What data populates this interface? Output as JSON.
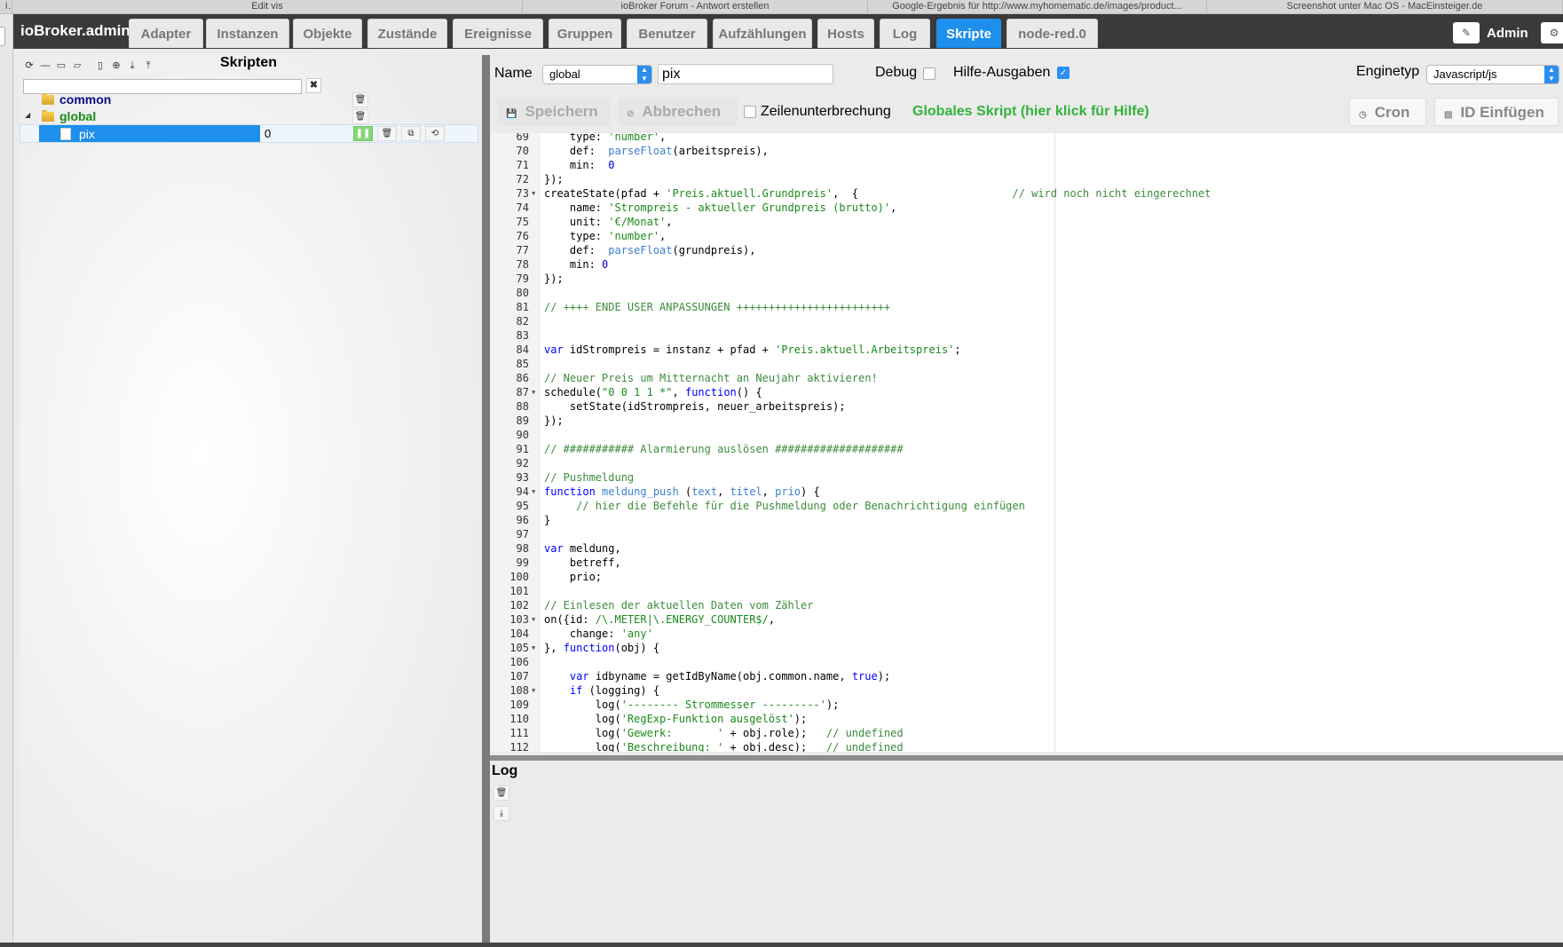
{
  "browser_tabs": [
    {
      "label": "in",
      "width": 14
    },
    {
      "label": "Edit vis",
      "width": 575
    },
    {
      "label": "ioBroker Forum - Antwort erstellen",
      "width": 389
    },
    {
      "label": "Google-Ergebnis für http://www.myhomematic.de/images/product...",
      "width": 382
    },
    {
      "label": "Screenshot unter Mac OS - MacEinsteiger.de",
      "width": 401
    }
  ],
  "brand": "ioBroker.admin",
  "nav_tabs": [
    {
      "name": "adapter",
      "label": "Adapter",
      "active": false
    },
    {
      "name": "instanzen",
      "label": "Instanzen",
      "active": false
    },
    {
      "name": "objekte",
      "label": "Objekte",
      "active": false
    },
    {
      "name": "zustaende",
      "label": "Zustände",
      "active": false
    },
    {
      "name": "ereignisse",
      "label": "Ereignisse",
      "active": false
    },
    {
      "name": "gruppen",
      "label": "Gruppen",
      "active": false
    },
    {
      "name": "benutzer",
      "label": "Benutzer",
      "active": false
    },
    {
      "name": "aufzaehlungen",
      "label": "Aufzählungen",
      "active": false
    },
    {
      "name": "hosts",
      "label": "Hosts",
      "active": false
    },
    {
      "name": "log",
      "label": "Log",
      "active": false
    },
    {
      "name": "skripte",
      "label": "Skripte",
      "active": true
    },
    {
      "name": "node-red",
      "label": "node-red.0",
      "active": false
    }
  ],
  "user": {
    "label": "Admin"
  },
  "scripts_panel": {
    "title": "Skripten",
    "search_value": "",
    "toolbar_icons": [
      "refresh-icon",
      "collapse-icon",
      "folder-icon",
      "folder-open-icon",
      "new-script-icon",
      "add-icon",
      "import-icon",
      "export-icon"
    ],
    "tree": [
      {
        "type": "folder",
        "label": "common",
        "color": "#0a0a8c",
        "expanded": false
      },
      {
        "type": "folder",
        "label": "global",
        "color": "#1a8a1a",
        "expanded": true
      },
      {
        "type": "script",
        "label": "pix",
        "count": "0",
        "selected": true
      }
    ]
  },
  "editor": {
    "name_label": "Name",
    "group_value": "global",
    "name_value": "pix",
    "debug_label": "Debug",
    "debug_checked": false,
    "help_output_label": "Hilfe-Ausgaben",
    "help_output_checked": true,
    "engine_label": "Enginetyp",
    "engine_value": "Javascript/js",
    "save_label": "Speichern",
    "cancel_label": "Abbrechen",
    "wrap_label": "Zeilenunterbrechung",
    "wrap_checked": false,
    "global_help": "Globales Skript (hier klick für Hilfe)",
    "cron_label": "Cron",
    "insert_id_label": "ID Einfügen"
  },
  "code_lines": [
    {
      "n": "69",
      "fold": false,
      "tokens": [
        [
          "",
          "    type: "
        ],
        [
          "st",
          "'number'"
        ],
        [
          "",
          ","
        ]
      ]
    },
    {
      "n": "70",
      "fold": false,
      "tokens": [
        [
          "",
          "    def:  "
        ],
        [
          "fn",
          "parseFloat"
        ],
        [
          "",
          "(arbeitspreis),"
        ]
      ]
    },
    {
      "n": "71",
      "fold": false,
      "tokens": [
        [
          "",
          "    min:  "
        ],
        [
          "nm",
          "0"
        ]
      ]
    },
    {
      "n": "72",
      "fold": false,
      "tokens": [
        [
          "",
          "});"
        ]
      ]
    },
    {
      "n": "73",
      "fold": true,
      "tokens": [
        [
          "",
          "createState(pfad + "
        ],
        [
          "st",
          "'Preis.aktuell.Grundpreis'"
        ],
        [
          "",
          ",  {                        "
        ],
        [
          "cm",
          "// wird noch nicht eingerechnet"
        ]
      ]
    },
    {
      "n": "74",
      "fold": false,
      "tokens": [
        [
          "",
          "    name: "
        ],
        [
          "st",
          "'Strompreis - aktueller Grundpreis (brutto)'"
        ],
        [
          "",
          ","
        ]
      ]
    },
    {
      "n": "75",
      "fold": false,
      "tokens": [
        [
          "",
          "    unit: "
        ],
        [
          "st",
          "'€/Monat'"
        ],
        [
          "",
          ","
        ]
      ]
    },
    {
      "n": "76",
      "fold": false,
      "tokens": [
        [
          "",
          "    type: "
        ],
        [
          "st",
          "'number'"
        ],
        [
          "",
          ","
        ]
      ]
    },
    {
      "n": "77",
      "fold": false,
      "tokens": [
        [
          "",
          "    def:  "
        ],
        [
          "fn",
          "parseFloat"
        ],
        [
          "",
          "(grundpreis),"
        ]
      ]
    },
    {
      "n": "78",
      "fold": false,
      "tokens": [
        [
          "",
          "    min: "
        ],
        [
          "nm",
          "0"
        ]
      ]
    },
    {
      "n": "79",
      "fold": false,
      "tokens": [
        [
          "",
          "});"
        ]
      ]
    },
    {
      "n": "80",
      "fold": false,
      "tokens": []
    },
    {
      "n": "81",
      "fold": false,
      "tokens": [
        [
          "cm",
          "// ++++ ENDE USER ANPASSUNGEN ++++++++++++++++++++++++"
        ]
      ]
    },
    {
      "n": "82",
      "fold": false,
      "tokens": []
    },
    {
      "n": "83",
      "fold": false,
      "tokens": []
    },
    {
      "n": "84",
      "fold": false,
      "tokens": [
        [
          "kw",
          "var"
        ],
        [
          "",
          " idStrompreis = instanz + pfad + "
        ],
        [
          "st",
          "'Preis.aktuell.Arbeitspreis'"
        ],
        [
          "",
          ";"
        ]
      ]
    },
    {
      "n": "85",
      "fold": false,
      "tokens": []
    },
    {
      "n": "86",
      "fold": false,
      "tokens": [
        [
          "cm",
          "// Neuer Preis um Mitternacht an Neujahr aktivieren!"
        ]
      ]
    },
    {
      "n": "87",
      "fold": true,
      "tokens": [
        [
          "",
          "schedule("
        ],
        [
          "st",
          "\"0 0 1 1 *\""
        ],
        [
          "",
          ", "
        ],
        [
          "kw",
          "function"
        ],
        [
          "",
          "() {"
        ]
      ]
    },
    {
      "n": "88",
      "fold": false,
      "tokens": [
        [
          "",
          "    setState(idStrompreis, neuer_arbeitspreis);"
        ]
      ]
    },
    {
      "n": "89",
      "fold": false,
      "tokens": [
        [
          "",
          "});"
        ]
      ]
    },
    {
      "n": "90",
      "fold": false,
      "tokens": []
    },
    {
      "n": "91",
      "fold": false,
      "tokens": [
        [
          "cm",
          "// ########### Alarmierung auslösen ####################"
        ]
      ]
    },
    {
      "n": "92",
      "fold": false,
      "tokens": []
    },
    {
      "n": "93",
      "fold": false,
      "tokens": [
        [
          "cm",
          "// Pushmeldung"
        ]
      ]
    },
    {
      "n": "94",
      "fold": true,
      "tokens": [
        [
          "kw",
          "function"
        ],
        [
          "",
          " "
        ],
        [
          "fn",
          "meldung_push"
        ],
        [
          "",
          " ("
        ],
        [
          "pm",
          "text"
        ],
        [
          "",
          ", "
        ],
        [
          "pm",
          "titel"
        ],
        [
          "",
          ", "
        ],
        [
          "pm",
          "prio"
        ],
        [
          "",
          ") {"
        ]
      ]
    },
    {
      "n": "95",
      "fold": false,
      "tokens": [
        [
          "",
          "     "
        ],
        [
          "cm",
          "// hier die Befehle für die Pushmeldung oder Benachrichtigung einfügen"
        ]
      ]
    },
    {
      "n": "96",
      "fold": false,
      "tokens": [
        [
          "",
          "}"
        ]
      ]
    },
    {
      "n": "97",
      "fold": false,
      "tokens": []
    },
    {
      "n": "98",
      "fold": false,
      "tokens": [
        [
          "kw",
          "var"
        ],
        [
          "",
          " meldung,"
        ]
      ]
    },
    {
      "n": "99",
      "fold": false,
      "tokens": [
        [
          "",
          "    betreff,"
        ]
      ]
    },
    {
      "n": "100",
      "fold": false,
      "tokens": [
        [
          "",
          "    prio;"
        ]
      ]
    },
    {
      "n": "101",
      "fold": false,
      "tokens": []
    },
    {
      "n": "102",
      "fold": false,
      "tokens": [
        [
          "cm",
          "// Einlesen der aktuellen Daten vom Zähler"
        ]
      ]
    },
    {
      "n": "103",
      "fold": true,
      "tokens": [
        [
          "",
          "on({id: "
        ],
        [
          "st",
          "/\\.METER|\\.ENERGY_COUNTER$/"
        ],
        [
          "",
          ","
        ]
      ]
    },
    {
      "n": "104",
      "fold": false,
      "tokens": [
        [
          "",
          "    change: "
        ],
        [
          "st",
          "'any'"
        ]
      ]
    },
    {
      "n": "105",
      "fold": true,
      "tokens": [
        [
          "",
          "}, "
        ],
        [
          "kw",
          "function"
        ],
        [
          "",
          "(obj) {"
        ]
      ]
    },
    {
      "n": "106",
      "fold": false,
      "tokens": []
    },
    {
      "n": "107",
      "fold": false,
      "tokens": [
        [
          "",
          "    "
        ],
        [
          "kw",
          "var"
        ],
        [
          "",
          " idbyname = getIdByName(obj.common.name, "
        ],
        [
          "kw",
          "true"
        ],
        [
          "",
          ");"
        ]
      ]
    },
    {
      "n": "108",
      "fold": true,
      "tokens": [
        [
          "",
          "    "
        ],
        [
          "kw",
          "if"
        ],
        [
          "",
          " (logging) {"
        ]
      ]
    },
    {
      "n": "109",
      "fold": false,
      "tokens": [
        [
          "",
          "        log("
        ],
        [
          "st",
          "'-------- Strommesser ---------'"
        ],
        [
          "",
          ");"
        ]
      ]
    },
    {
      "n": "110",
      "fold": false,
      "tokens": [
        [
          "",
          "        log("
        ],
        [
          "st",
          "'RegExp-Funktion ausgelöst'"
        ],
        [
          "",
          ");"
        ]
      ]
    },
    {
      "n": "111",
      "fold": false,
      "tokens": [
        [
          "",
          "        log("
        ],
        [
          "st",
          "'Gewerk:       '"
        ],
        [
          "",
          " + obj.role);   "
        ],
        [
          "cm",
          "// undefined"
        ]
      ]
    },
    {
      "n": "112",
      "fold": false,
      "tokens": [
        [
          "",
          "        log("
        ],
        [
          "st",
          "'Beschreibung: '"
        ],
        [
          "",
          " + obj.desc);   "
        ],
        [
          "cm",
          "// undefined"
        ]
      ]
    }
  ],
  "log_panel": {
    "title": "Log"
  }
}
